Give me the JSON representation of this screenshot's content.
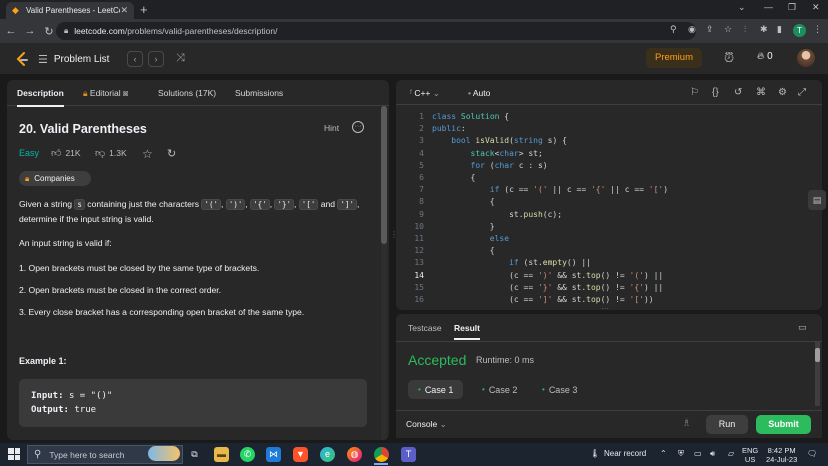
{
  "browser": {
    "tab_title": "Valid Parentheses - LeetCode",
    "url_host": "leetcode.com",
    "url_path": "/problems/valid-parentheses/description/",
    "avatar_letter": "T"
  },
  "header": {
    "problem_list": "Problem List",
    "premium": "Premium",
    "streak": "0"
  },
  "left_tabs": [
    "Description",
    "Editorial",
    "Solutions (17K)",
    "Submissions"
  ],
  "problem": {
    "title": "20. Valid Parentheses",
    "hint": "Hint",
    "difficulty": "Easy",
    "likes": "21K",
    "dislikes": "1.3K",
    "companies": "Companies",
    "desc_a": "Given a string ",
    "desc_s": "s",
    "desc_b": " containing just the characters ",
    "chars": [
      "'('",
      "')'",
      "'{'",
      "'}'",
      "'['",
      "']'"
    ],
    "desc_and": " and ",
    "desc_c": "determine if the input string is valid.",
    "valid_if": "An input string is valid if:",
    "rules": [
      "1. Open brackets must be closed by the same type of brackets.",
      "2. Open brackets must be closed in the correct order.",
      "3. Every close bracket has a corresponding open bracket of the same type."
    ],
    "example_heading": "Example 1:",
    "example_input_label": "Input:",
    "example_input": "s = \"()\"",
    "example_output_label": "Output:",
    "example_output": "true"
  },
  "editor": {
    "language": "C++",
    "mode": "Auto",
    "current_line": 14,
    "lines": [
      {
        "n": "1",
        "html": "<span class='kw'>class</span> <span class='ty'>Solution</span> {"
      },
      {
        "n": "2",
        "html": "<span class='kw'>public</span>:"
      },
      {
        "n": "3",
        "html": "    <span class='kw'>bool</span> <span class='fn'>isValid</span>(<span class='kw'>string</span> s) {"
      },
      {
        "n": "4",
        "html": "        <span class='ty'>stack</span>&lt;<span class='kw'>char</span>&gt; st;"
      },
      {
        "n": "5",
        "html": "        <span class='kw'>for</span> (<span class='kw'>char</span> c : s)"
      },
      {
        "n": "6",
        "html": "        {"
      },
      {
        "n": "7",
        "html": "            <span class='kw'>if</span> (c == <span class='st'>'('</span> || c == <span class='st'>'{'</span> || c == <span class='st'>'['</span>)"
      },
      {
        "n": "8",
        "html": "            {"
      },
      {
        "n": "9",
        "html": "                st.<span class='fn'>push</span>(c);"
      },
      {
        "n": "10",
        "html": "            }"
      },
      {
        "n": "11",
        "html": "            <span class='kw'>else</span>"
      },
      {
        "n": "12",
        "html": "            {"
      },
      {
        "n": "13",
        "html": "                <span class='kw'>if</span> (st.<span class='fn'>empty</span>() ||"
      },
      {
        "n": "14",
        "html": "                (c == <span class='st'>')'</span> &amp;&amp; st.<span class='fn'>top</span>() != <span class='st'>'('</span>) ||"
      },
      {
        "n": "15",
        "html": "                (c == <span class='st'>'}'</span> &amp;&amp; st.<span class='fn'>top</span>() != <span class='st'>'{'</span>) ||"
      },
      {
        "n": "16",
        "html": "                (c == <span class='st'>']'</span> &amp;&amp; st.<span class='fn'>top</span>() != <span class='st'>'['</span>))"
      }
    ]
  },
  "console": {
    "tab_testcase": "Testcase",
    "tab_result": "Result",
    "status": "Accepted",
    "runtime": "Runtime: 0 ms",
    "cases": [
      "Case 1",
      "Case 2",
      "Case 3"
    ],
    "console_label": "Console",
    "run": "Run",
    "submit": "Submit"
  },
  "taskbar": {
    "search_placeholder": "Type here to search",
    "weather": "Near record",
    "lang": "ENG",
    "region": "US",
    "time": "8:42 PM",
    "date": "24-Jul-23"
  },
  "colors": {
    "accent_green": "#2cbb5d",
    "easy_teal": "#00b8a3",
    "premium_orange": "#ffa116"
  }
}
